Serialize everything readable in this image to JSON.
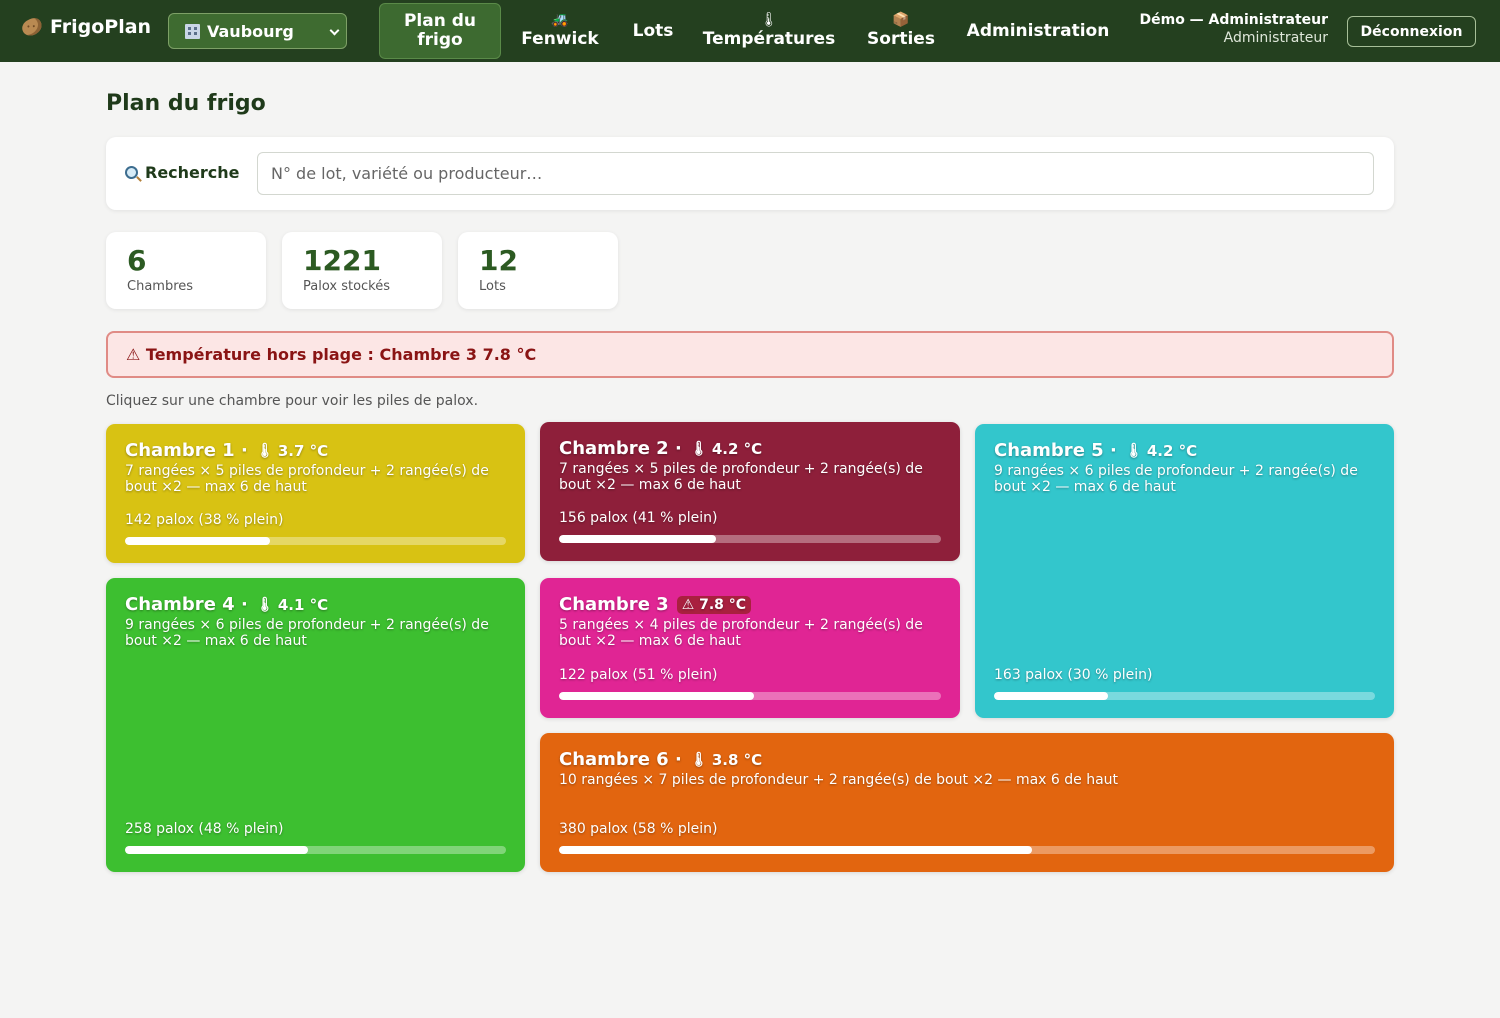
{
  "app": {
    "name": "FrigoPlan",
    "site": "Vaubourg"
  },
  "nav": [
    {
      "label": "Plan du frigo",
      "icon": "",
      "active": true
    },
    {
      "label": "Fenwick",
      "icon": "tractor-icon",
      "active": false
    },
    {
      "label": "Lots",
      "icon": "",
      "active": false
    },
    {
      "label": "Températures",
      "icon": "thermometer-icon",
      "active": false
    },
    {
      "label": "Sorties",
      "icon": "package-icon",
      "active": false
    },
    {
      "label": "Administration",
      "icon": "",
      "active": false
    }
  ],
  "user": {
    "name": "Démo — Administrateur",
    "role": "Administrateur",
    "logout": "Déconnexion"
  },
  "page": {
    "title": "Plan du frigo"
  },
  "search": {
    "label": "Recherche",
    "placeholder": "N° de lot, variété ou producteur…"
  },
  "stats": [
    {
      "value": "6",
      "label": "Chambres"
    },
    {
      "value": "1221",
      "label": "Palox stockés"
    },
    {
      "value": "12",
      "label": "Lots"
    }
  ],
  "alert": {
    "text": "⚠ Température hors plage : Chambre 3 7.8 °C"
  },
  "hint": "Cliquez sur une chambre pour voir les piles de palox.",
  "chambers": [
    {
      "name": "Chambre 1",
      "temp": "3.7 °C",
      "alert": false,
      "desc": "7 rangées × 5 piles de profondeur + 2 rangée(s) de bout ×2 — max 6 de haut",
      "count": "142 palox (38 % plein)",
      "fill": 0.38,
      "color": "#d8c213"
    },
    {
      "name": "Chambre 2",
      "temp": "4.2 °C",
      "alert": false,
      "desc": "7 rangées × 5 piles de profondeur + 2 rangée(s) de bout ×2 — max 6 de haut",
      "count": "156 palox (41 % plein)",
      "fill": 0.41,
      "color": "#8e1f3a"
    },
    {
      "name": "Chambre 5",
      "temp": "4.2 °C",
      "alert": false,
      "desc": "9 rangées × 6 piles de profondeur + 2 rangée(s) de bout ×2 — max 6 de haut",
      "count": "163 palox (30 % plein)",
      "fill": 0.3,
      "color": "#33c6cc"
    },
    {
      "name": "Chambre 4",
      "temp": "4.1 °C",
      "alert": false,
      "desc": "9 rangées × 6 piles de profondeur + 2 rangée(s) de bout ×2 — max 6 de haut",
      "count": "258 palox (48 % plein)",
      "fill": 0.48,
      "color": "#3dbf30"
    },
    {
      "name": "Chambre 3",
      "temp": "7.8 °C",
      "alert": true,
      "desc": "5 rangées × 4 piles de profondeur + 2 rangée(s) de bout ×2 — max 6 de haut",
      "count": "122 palox (51 % plein)",
      "fill": 0.51,
      "color": "#e02594"
    },
    {
      "name": "Chambre 6",
      "temp": "3.8 °C",
      "alert": false,
      "desc": "10 rangées × 7 piles de profondeur + 2 rangée(s) de bout ×2 — max 6 de haut",
      "count": "380 palox (58 % plein)",
      "fill": 0.58,
      "color": "#e2650f"
    }
  ]
}
